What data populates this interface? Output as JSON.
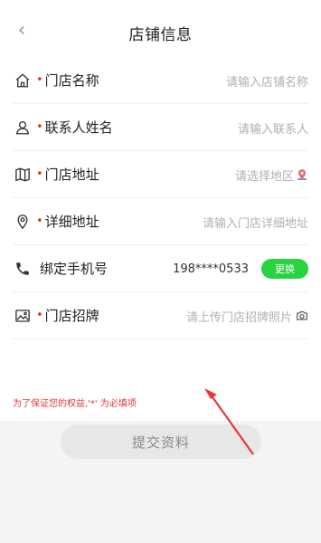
{
  "header": {
    "back_icon": "chevron-left-icon",
    "title": "店铺信息"
  },
  "form": {
    "rows": [
      {
        "icon": "home-icon",
        "label": "门店名称",
        "required": true,
        "placeholder": "请输入店铺名称"
      },
      {
        "icon": "person-icon",
        "label": "联系人姓名",
        "required": true,
        "placeholder": "请输入联系人"
      },
      {
        "icon": "map-icon",
        "label": "门店地址",
        "required": true,
        "placeholder": "请选择地区",
        "trail_icon": "location-pin-icon"
      },
      {
        "icon": "location-icon",
        "label": "详细地址",
        "required": true,
        "placeholder": "请输入门店详细地址"
      },
      {
        "icon": "phone-icon",
        "label": "绑定手机号",
        "required": false,
        "value": "198****0533",
        "button": "更换"
      },
      {
        "icon": "image-icon",
        "label": "门店招牌",
        "required": true,
        "placeholder": "请上传门店招牌照片",
        "trail_icon": "camera-icon"
      }
    ],
    "notice": "为了保证您的权益,'*' 为必填项"
  },
  "submit_label": "提交资料",
  "colors": {
    "required": "#e0382f",
    "button_green": "#27d33f",
    "submit_bg": "#e7e7e7",
    "arrow": "#e53935"
  }
}
